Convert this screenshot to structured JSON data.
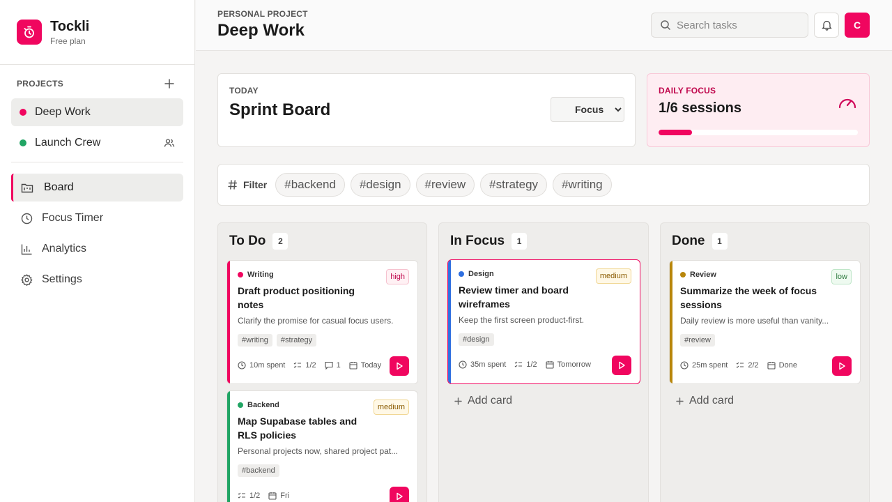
{
  "brand": {
    "name": "Tockli",
    "plan": "Free plan",
    "icon": "timer-icon",
    "accent": "#f0065f"
  },
  "projects": {
    "heading": "PROJECTS",
    "items": [
      {
        "label": "Deep Work",
        "color": "#f0065f",
        "active": true
      },
      {
        "label": "Launch Crew",
        "color": "#21a564",
        "shared": true
      }
    ]
  },
  "nav": [
    {
      "label": "Board",
      "icon": "board-icon",
      "active": true
    },
    {
      "label": "Focus Timer",
      "icon": "clock-icon"
    },
    {
      "label": "Analytics",
      "icon": "chart-icon"
    },
    {
      "label": "Settings",
      "icon": "gear-icon"
    }
  ],
  "header": {
    "crumb": "PERSONAL PROJECT",
    "title": "Deep Work",
    "search_placeholder": "Search tasks",
    "avatar": "C"
  },
  "sprint": {
    "kicker": "TODAY",
    "title": "Sprint Board",
    "view_selected": "Focus"
  },
  "daily_focus": {
    "kicker": "DAILY FOCUS",
    "value": "1/6 sessions",
    "progress_fraction": 0.1667
  },
  "filter": {
    "label": "Filter",
    "tags": [
      "#backend",
      "#design",
      "#review",
      "#strategy",
      "#writing"
    ]
  },
  "columns": [
    {
      "title": "To Do",
      "count": "2",
      "cards": [
        {
          "category": "Writing",
          "cat_color": "#f0065f",
          "bar_color": "#f0065f",
          "priority": "high",
          "title": "Draft product positioning notes",
          "desc": "Clarify the promise for casual focus users.",
          "tags": [
            "#writing",
            "#strategy"
          ],
          "spent": "10m spent",
          "checks": "1/2",
          "comments": "1",
          "due": "Today"
        },
        {
          "category": "Backend",
          "cat_color": "#21a564",
          "bar_color": "#21a564",
          "priority": "medium",
          "title": "Map Supabase tables and RLS policies",
          "desc": "Personal projects now, shared project pat...",
          "tags": [
            "#backend"
          ],
          "checks": "1/2",
          "due": "Fri"
        }
      ]
    },
    {
      "title": "In Focus",
      "count": "1",
      "cards": [
        {
          "category": "Design",
          "cat_color": "#2f6fe0",
          "bar_color": "#2f6fe0",
          "priority": "medium",
          "title": "Review timer and board wireframes",
          "desc": "Keep the first screen product-first.",
          "tags": [
            "#design"
          ],
          "spent": "35m spent",
          "checks": "1/2",
          "due": "Tomorrow"
        }
      ],
      "add_label": "Add card"
    },
    {
      "title": "Done",
      "count": "1",
      "cards": [
        {
          "category": "Review",
          "cat_color": "#b8860b",
          "bar_color": "#b8860b",
          "priority": "low",
          "title": "Summarize the week of focus sessions",
          "desc": "Daily review is more useful than vanity...",
          "tags": [
            "#review"
          ],
          "spent": "25m spent",
          "checks": "2/2",
          "due": "Done"
        }
      ],
      "add_label": "Add card"
    }
  ]
}
